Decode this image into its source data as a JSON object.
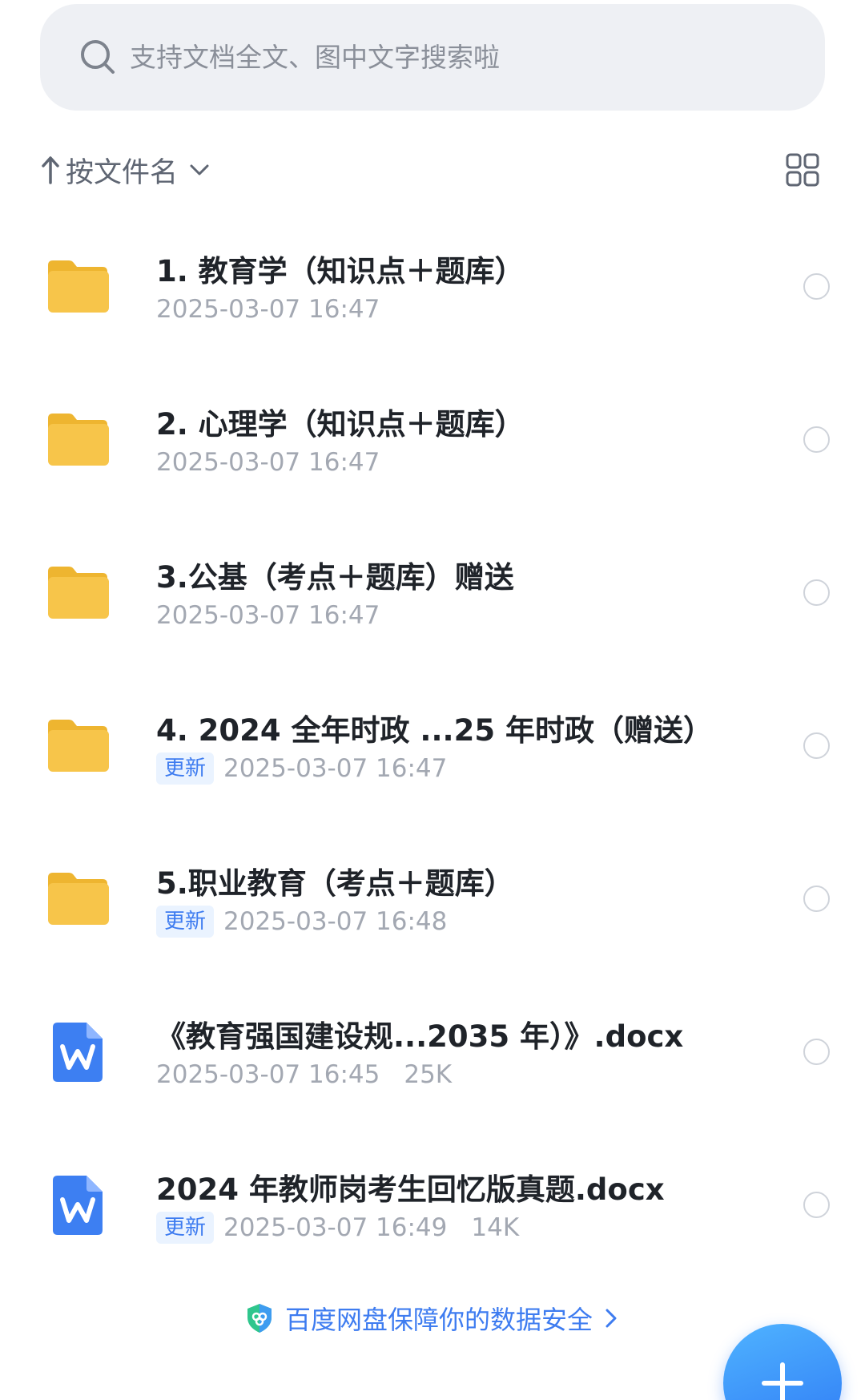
{
  "search": {
    "placeholder": "支持文档全文、图中文字搜索啦",
    "value": ""
  },
  "sort": {
    "label": "按文件名"
  },
  "colors": {
    "accent": "#3e7cf0",
    "folder": "#f7c54a",
    "word": "#3d7ff2",
    "badge_bg": "#eaf3ff"
  },
  "files": [
    {
      "type": "folder",
      "icon": "folder-icon",
      "name": "1. 教育学（知识点＋题库）",
      "badge": "",
      "date": "2025-03-07 16:47",
      "size": ""
    },
    {
      "type": "folder",
      "icon": "folder-icon",
      "name": "2. 心理学（知识点＋题库）",
      "badge": "",
      "date": "2025-03-07 16:47",
      "size": ""
    },
    {
      "type": "folder",
      "icon": "folder-icon",
      "name": "3.公基（考点＋题库）赠送",
      "badge": "",
      "date": "2025-03-07 16:47",
      "size": ""
    },
    {
      "type": "folder",
      "icon": "folder-icon",
      "name": "4. 2024 全年时政 ...25 年时政（赠送）",
      "badge": "更新",
      "date": "2025-03-07 16:47",
      "size": ""
    },
    {
      "type": "folder",
      "icon": "folder-icon",
      "name": "5.职业教育（考点＋题库）",
      "badge": "更新",
      "date": "2025-03-07 16:48",
      "size": ""
    },
    {
      "type": "docx",
      "icon": "word-doc-icon",
      "name": "《教育强国建设规...2035 年）》.docx",
      "badge": "",
      "date": "2025-03-07 16:45",
      "size": "25K"
    },
    {
      "type": "docx",
      "icon": "word-doc-icon",
      "name": "2024 年教师岗考生回忆版真题.docx",
      "badge": "更新",
      "date": "2025-03-07 16:49",
      "size": "14K"
    }
  ],
  "footer": {
    "text": "百度网盘保障你的数据安全"
  }
}
